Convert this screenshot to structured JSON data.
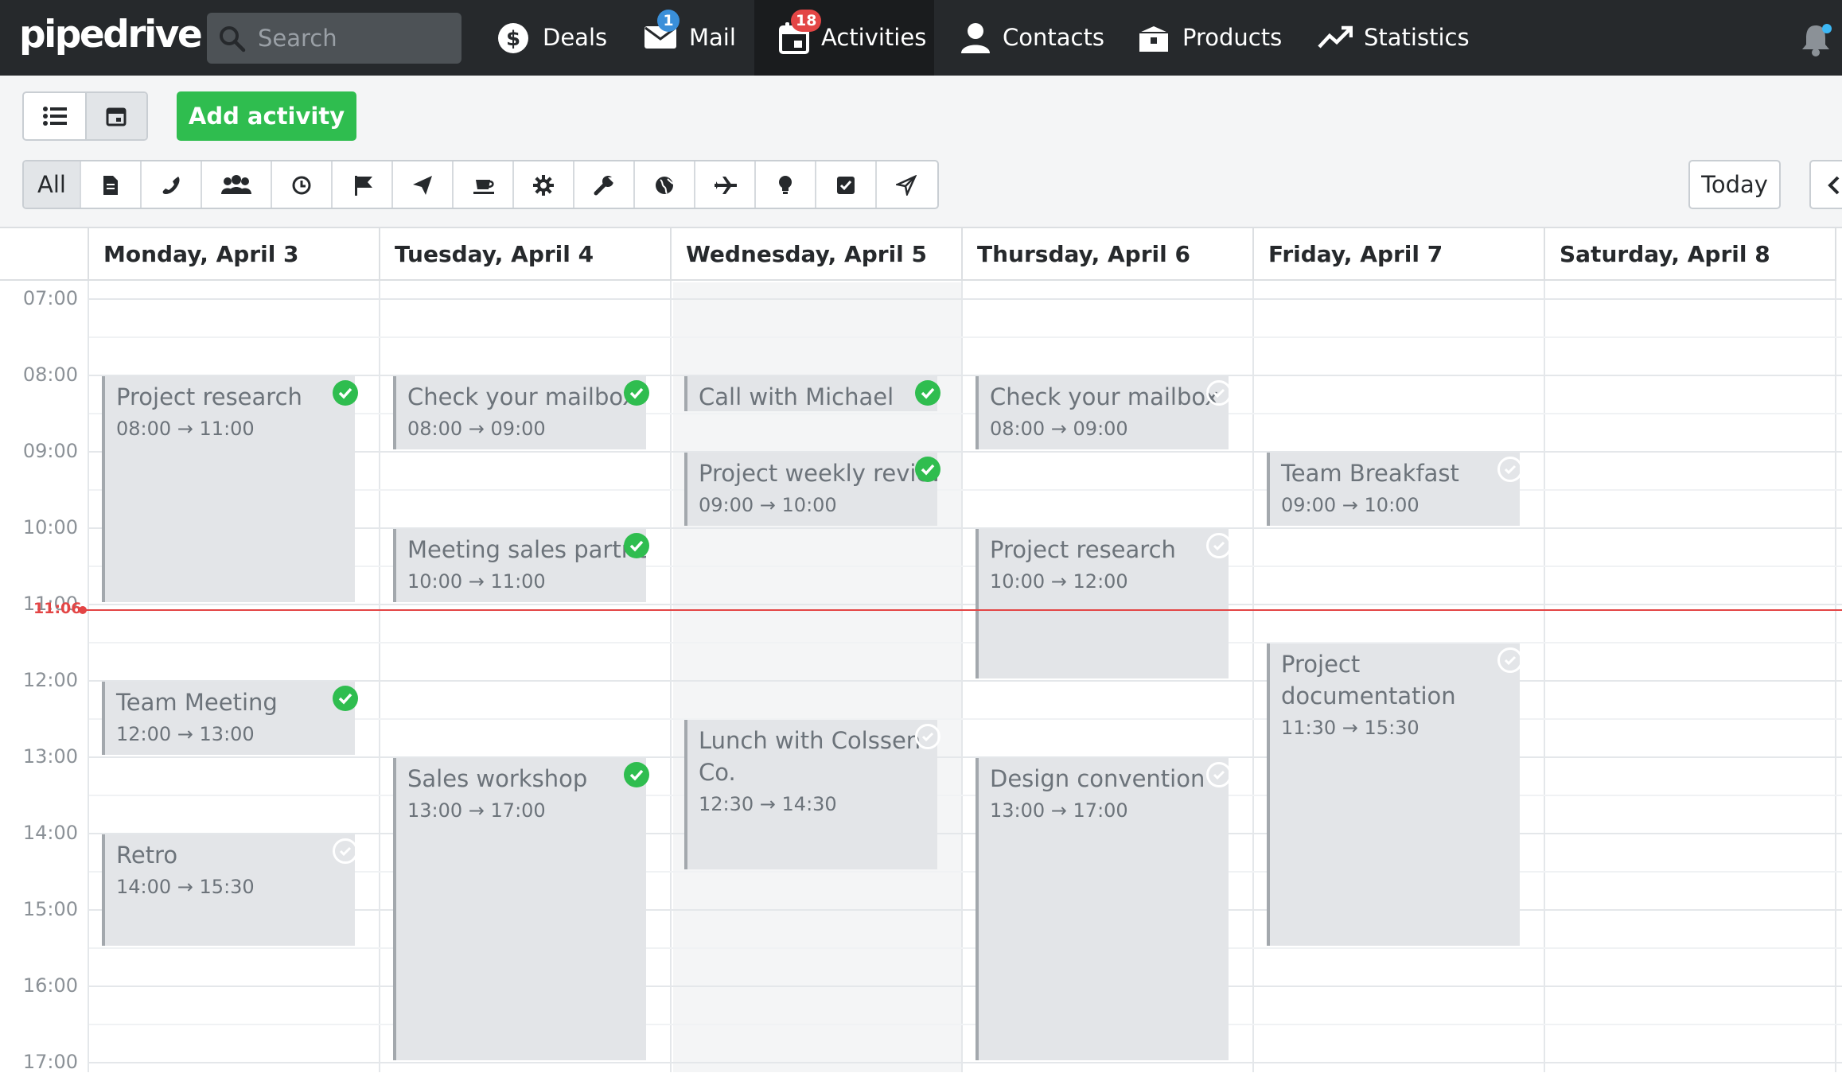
{
  "app": {
    "logo_text": "pipedrive"
  },
  "search": {
    "placeholder": "Search"
  },
  "nav": {
    "deals": "Deals",
    "mail": "Mail",
    "mail_badge": "1",
    "activities": "Activities",
    "activities_badge": "18",
    "contacts": "Contacts",
    "products": "Products",
    "statistics": "Statistics"
  },
  "toolbar": {
    "add_activity": "Add activity",
    "filter_all": "All",
    "today": "Today",
    "filter_icons": [
      "document-icon",
      "phone-icon",
      "group-icon",
      "clock-icon",
      "flag-icon",
      "send-icon",
      "coffee-icon",
      "gear-icon",
      "wrench-icon",
      "globe-icon",
      "plane-icon",
      "lightbulb-icon",
      "checkbox-icon",
      "paper-plane-icon"
    ]
  },
  "calendar": {
    "days": [
      "Monday, April 3",
      "Tuesday, April 4",
      "Wednesday, April 5",
      "Thursday, April 6",
      "Friday, April 7",
      "Saturday, April 8"
    ],
    "hours": [
      "07:00",
      "08:00",
      "09:00",
      "10:00",
      "11:00",
      "12:00",
      "13:00",
      "14:00",
      "15:00",
      "16:00",
      "17:00"
    ],
    "now": "11:06",
    "events": [
      {
        "day": 0,
        "title": "Project research",
        "time": "08:00 → 11:00",
        "start": 8,
        "end": 11,
        "done": true
      },
      {
        "day": 0,
        "title": "Team Meeting",
        "time": "12:00 → 13:00",
        "start": 12,
        "end": 13,
        "done": true
      },
      {
        "day": 0,
        "title": "Retro",
        "time": "14:00 → 15:30",
        "start": 14,
        "end": 15.5,
        "done": false
      },
      {
        "day": 1,
        "title": "Check your mailbox",
        "time": "08:00 → 09:00",
        "start": 8,
        "end": 9,
        "done": true
      },
      {
        "day": 1,
        "title": "Meeting sales partner",
        "time": "10:00 → 11:00",
        "start": 10,
        "end": 11,
        "done": true
      },
      {
        "day": 1,
        "title": "Sales workshop",
        "time": "13:00 → 17:00",
        "start": 13,
        "end": 17,
        "done": true
      },
      {
        "day": 2,
        "title": "Call with Michael",
        "time": "",
        "start": 8,
        "end": 8.5,
        "done": true
      },
      {
        "day": 2,
        "title": "Project weekly review",
        "time": "09:00 → 10:00",
        "start": 9,
        "end": 10,
        "done": true
      },
      {
        "day": 2,
        "title": "Lunch with Colssen Co.",
        "time": "12:30 → 14:30",
        "start": 12.5,
        "end": 14.5,
        "done": false,
        "wrap": true
      },
      {
        "day": 3,
        "title": "Check your mailbox",
        "time": "08:00 → 09:00",
        "start": 8,
        "end": 9,
        "done": false
      },
      {
        "day": 3,
        "title": "Project research",
        "time": "10:00 → 12:00",
        "start": 10,
        "end": 12,
        "done": false
      },
      {
        "day": 3,
        "title": "Design convention",
        "time": "13:00 → 17:00",
        "start": 13,
        "end": 17,
        "done": false
      },
      {
        "day": 4,
        "title": "Team Breakfast",
        "time": "09:00 → 10:00",
        "start": 9,
        "end": 10,
        "done": false
      },
      {
        "day": 4,
        "title": "Project documentation",
        "time": "11:30 → 15:30",
        "start": 11.5,
        "end": 15.5,
        "done": false,
        "wrap": true
      }
    ]
  },
  "colors": {
    "topbar": "#26292c",
    "accent_green": "#2fbd4f",
    "now_line": "#e34545",
    "mail_badge": "#3a8fd9",
    "activities_badge": "#e34545"
  }
}
